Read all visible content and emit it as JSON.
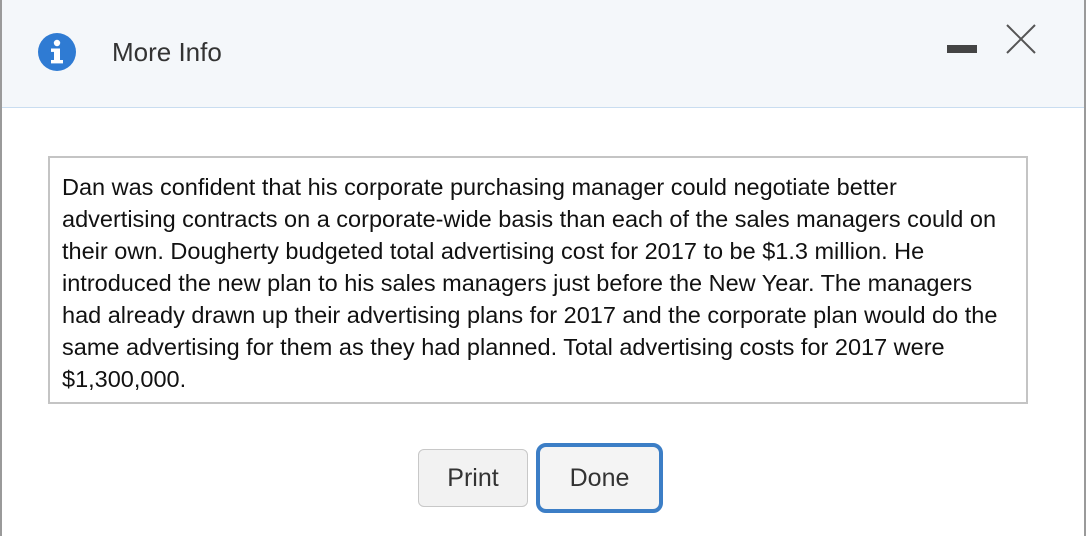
{
  "dialog": {
    "title": "More Info",
    "icon": "info-icon",
    "accent_color": "#2f7bd3"
  },
  "content": {
    "text": "Dan was confident that his corporate purchasing manager could negotiate better advertising contracts on a corporate-wide basis than each of the sales managers could on their own. Dougherty budgeted total advertising cost for 2017 to be $1.3 million. He introduced the new plan to his sales managers just before the New Year. The managers had already drawn up their advertising plans for 2017 and the corporate plan would do the same advertising for them as they had planned. Total advertising costs for 2017 were $1,300,000."
  },
  "buttons": {
    "print_label": "Print",
    "done_label": "Done"
  }
}
